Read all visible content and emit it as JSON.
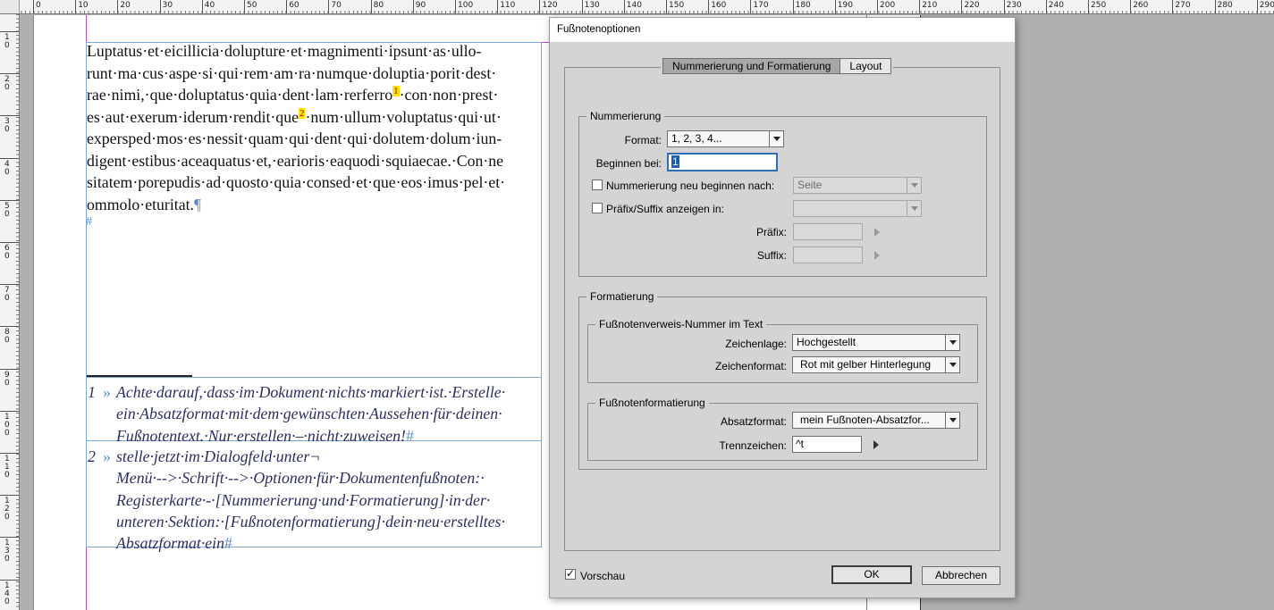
{
  "ruler": {
    "h_labels": [
      "0",
      "10",
      "20",
      "30",
      "40",
      "50",
      "60",
      "70",
      "80",
      "90",
      "100",
      "110",
      "120",
      "130",
      "140",
      "150",
      "160",
      "170",
      "180",
      "190",
      "200",
      "210",
      "220",
      "230",
      "240",
      "250",
      "260",
      "270",
      "280",
      "290"
    ],
    "v_labels": [
      "10",
      "20",
      "30",
      "40",
      "50",
      "60",
      "70",
      "80",
      "90",
      "100",
      "110",
      "120",
      "130",
      "140"
    ]
  },
  "document": {
    "body_lines": [
      "Luptatus·et·eicillicia·dolupture·et·magnimenti·ipsunt·as·ullo-",
      "runt·ma·cus·aspe·si·qui·rem·am·ra·numque·doluptia·porit·dest·",
      "rae·nimi,·que·doluptatus·quia·dent·lam·rerferro",
      "es·aut·exerum·iderum·rendit·que",
      "expersped·mos·es·nessit·quam·qui·dent·qui·dolutem·dolum·iun-",
      "digent·estibus·aceaquatus·et,·earioris·eaquodi·squiaecae.·Con·ne",
      "sitatem·porepudis·ad·quosto·quia·consed·et·que·eos·imus·pel·et·",
      "ommolo·eturitat."
    ],
    "line3_tail": "·con·non·prest·",
    "line4_tail": "·num·ullum·voluptatus·qui·ut·",
    "fn_ref_1": "1",
    "fn_ref_2": "2",
    "pilcrow": "¶",
    "hash": "#",
    "footnotes": [
      {
        "num": "1",
        "marker": "»",
        "lines": [
          "Achte·darauf,·dass·im·Dokument·nichts·markiert·ist.·Erstelle·",
          "ein·Absatzformat·mit·dem·gewünschten·Aussehen·für·deinen·",
          "Fußnotentext.·Nur·erstellen·–·nicht·zuweisen!"
        ]
      },
      {
        "num": "2",
        "marker": "»",
        "lines": [
          "stelle·jetzt·im·Dialogfeld·unter¬",
          "Menü·-->·Schrift·-->·Optionen·für·Dokumentenfußnoten:·",
          "Registerkarte·-·[Nummerierung·und·Formatierung]·in·der·",
          "unteren·Sektion:·[Fußnotenformatierung]·dein·neu·erstelltes·",
          "Absatzformat·ein"
        ]
      }
    ]
  },
  "dialog": {
    "title": "Fußnotenoptionen",
    "tabs": [
      "Nummerierung und Formatierung",
      "Layout"
    ],
    "numbering": {
      "legend": "Nummerierung",
      "format_label": "Format:",
      "format_value": "1, 2, 3, 4...",
      "start_label": "Beginnen bei:",
      "start_value": "1",
      "restart_label": "Nummerierung neu beginnen nach:",
      "restart_value": "Seite",
      "prefix_suffix_label": "Präfix/Suffix anzeigen in:",
      "prefix_label": "Präfix:",
      "suffix_label": "Suffix:"
    },
    "formatting": {
      "legend": "Formatierung",
      "ref_legend": "Fußnotenverweis-Nummer im Text",
      "position_label": "Zeichenlage:",
      "position_value": "Hochgestellt",
      "charstyle_label": "Zeichenformat:",
      "charstyle_value": "Rot mit gelber Hinterlegung",
      "fn_legend": "Fußnotenformatierung",
      "parastyle_label": "Absatzformat:",
      "parastyle_value": "mein Fußnoten-Absatzfor...",
      "separator_label": "Trennzeichen:",
      "separator_value": "^t"
    },
    "preview_label": "Vorschau",
    "ok_label": "OK",
    "cancel_label": "Abbrechen"
  }
}
